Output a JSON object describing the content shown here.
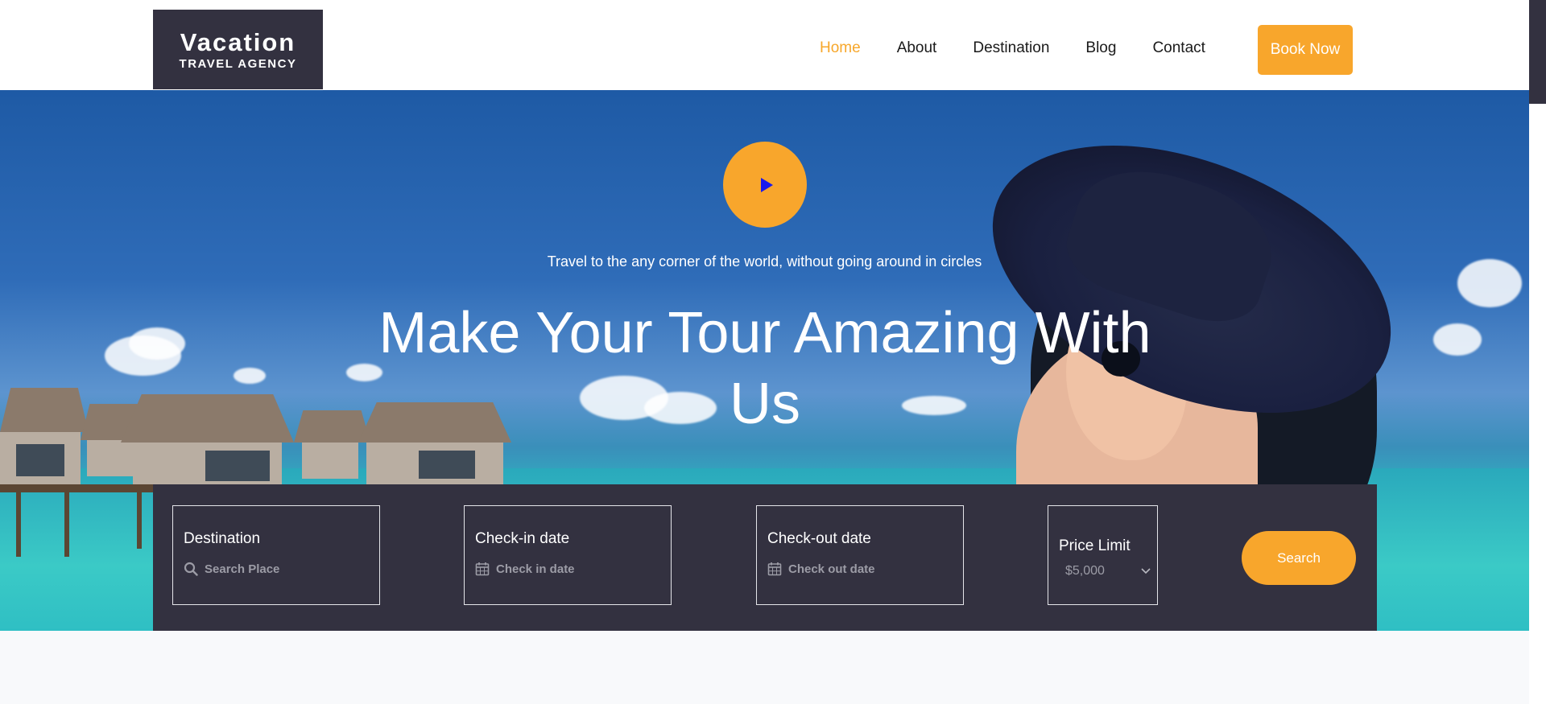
{
  "brand": {
    "name": "Vacation",
    "tagline": "TRAVEL AGENCY"
  },
  "nav": {
    "items": [
      {
        "label": "Home",
        "active": true
      },
      {
        "label": "About",
        "active": false
      },
      {
        "label": "Destination",
        "active": false
      },
      {
        "label": "Blog",
        "active": false
      },
      {
        "label": "Contact",
        "active": false
      }
    ],
    "cta_label": "Book Now"
  },
  "hero": {
    "subtitle": "Travel to the any corner of the world, without going around in circles",
    "title": "Make Your Tour Amazing With Us",
    "play_icon": "play-icon"
  },
  "search": {
    "destination": {
      "label": "Destination",
      "placeholder": "Search Place",
      "icon": "search-icon"
    },
    "checkin": {
      "label": "Check-in date",
      "placeholder": "Check in date",
      "icon": "calendar-icon"
    },
    "checkout": {
      "label": "Check-out date",
      "placeholder": "Check out date",
      "icon": "calendar-icon"
    },
    "price": {
      "label": "Price Limit",
      "selected": "$5,000",
      "icon": "chevron-down-icon"
    },
    "button_label": "Search"
  },
  "colors": {
    "accent": "#f8a62c",
    "dark": "#333140"
  }
}
